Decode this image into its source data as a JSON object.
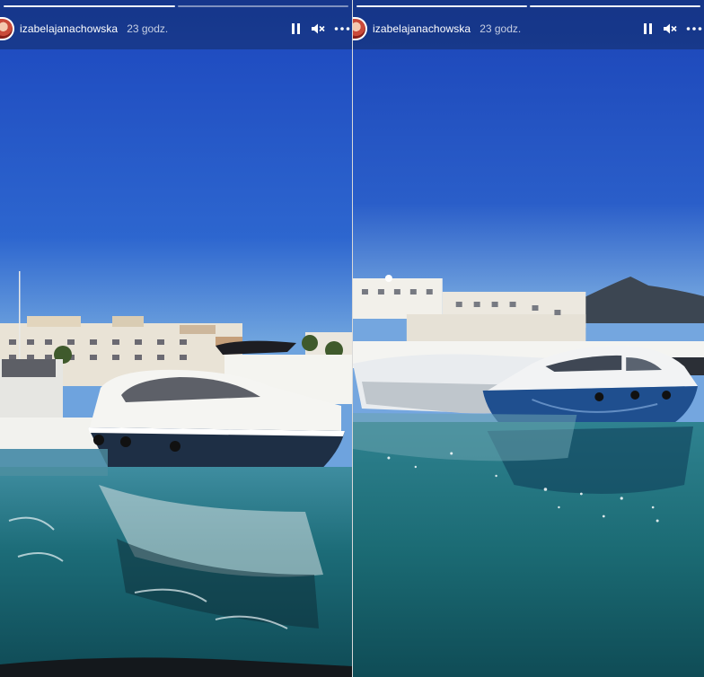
{
  "stories": [
    {
      "username": "izabelajanachowska",
      "time_ago": "23 godz.",
      "progress": [
        1,
        0
      ],
      "icons": {
        "pause": "pause-icon",
        "mute": "muted-speaker-icon",
        "more": "more-options-icon"
      }
    },
    {
      "username": "izabelajanachowska",
      "time_ago": "23 godz.",
      "progress": [
        1,
        1
      ],
      "icons": {
        "pause": "pause-icon",
        "mute": "muted-speaker-icon",
        "more": "more-options-icon"
      }
    }
  ],
  "colors": {
    "sky_top": "#1f4ec4",
    "sky_horizon": "#6aa0de",
    "water": "#1a6f7a",
    "yacht_hull_dark": "#1d2f45",
    "yacht_hull_blue": "#1f4f8f"
  }
}
